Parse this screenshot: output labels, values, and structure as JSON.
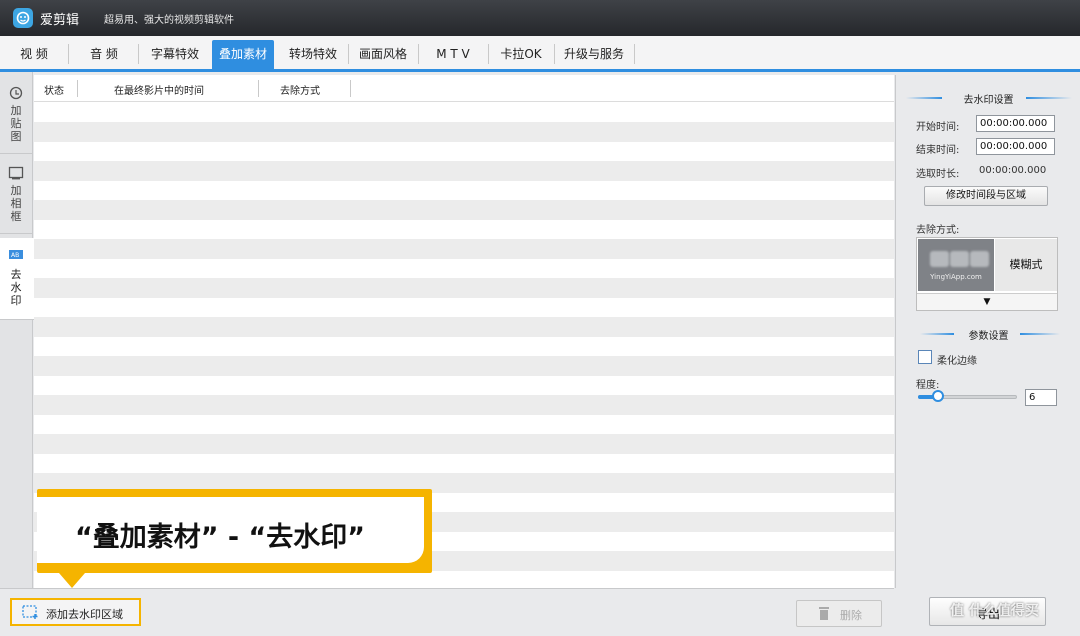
{
  "titlebar": {
    "app_name": "爱剪辑",
    "slogan": "超易用、强大的视频剪辑软件"
  },
  "tabs": [
    {
      "label": "视  频"
    },
    {
      "label": "音  频"
    },
    {
      "label": "字幕特效"
    },
    {
      "label": "叠加素材"
    },
    {
      "label": "转场特效"
    },
    {
      "label": "画面风格"
    },
    {
      "label": "M T V"
    },
    {
      "label": "卡拉OK"
    },
    {
      "label": "升级与服务"
    }
  ],
  "side_tabs": [
    {
      "label": "加贴图"
    },
    {
      "label": "加相框"
    },
    {
      "label": "去水印"
    }
  ],
  "table": {
    "columns": [
      "状态",
      "在最终影片中的时间",
      "去除方式"
    ]
  },
  "bottom": {
    "add_region_label": "添加去水印区域",
    "delete_label": "删除"
  },
  "callout": {
    "text": "“叠加素材” - “去水印”"
  },
  "right_panel": {
    "section1_title": "去水印设置",
    "start_label": "开始时间:",
    "start_value": "00:00:00.000",
    "end_label": "结束时间:",
    "end_value": "00:00:00.000",
    "duration_label": "选取时长:",
    "duration_value": "00:00:00.000",
    "modify_button": "修改时间段与区域",
    "remove_mode_label": "去除方式:",
    "mode_preview_text": "YingYiApp.com",
    "mode_value": "模糊式",
    "dropdown_arrow": "▼",
    "section2_title": "参数设置",
    "soften_label": "柔化边缘",
    "degree_label": "程度:",
    "degree_value": "6",
    "slider_level_fraction": 0.2
  },
  "export": {
    "label": "导出"
  },
  "watermark": "值 什么值得买",
  "colors": {
    "accent": "#2f8ee0",
    "callout": "#f5b400",
    "titlebar": "#2f3135"
  }
}
